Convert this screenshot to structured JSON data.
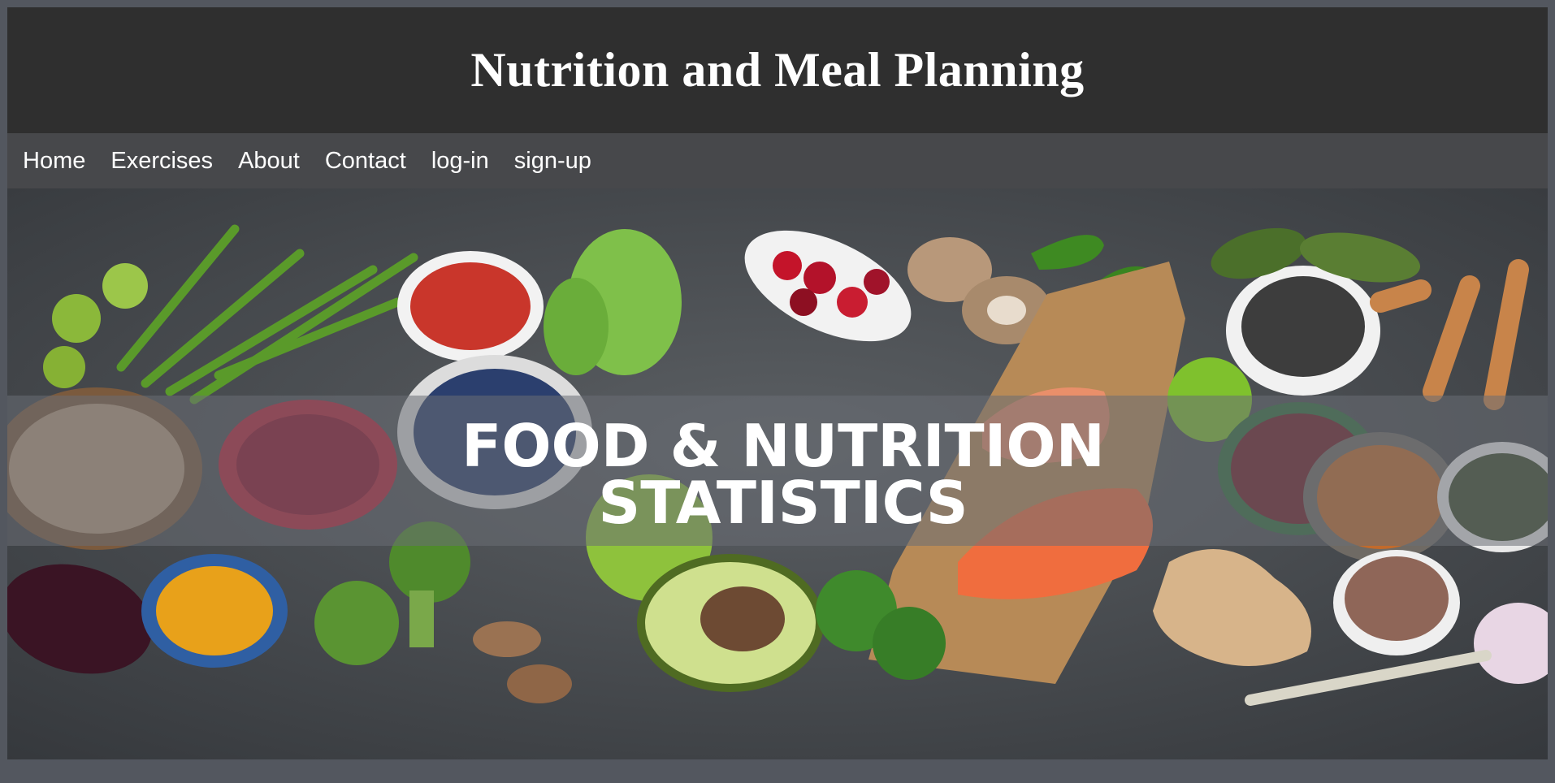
{
  "site": {
    "title": "Nutrition and Meal Planning"
  },
  "nav": {
    "items": [
      "Home",
      "Exercises",
      "About",
      "Contact",
      "log-in",
      "sign-up"
    ]
  },
  "hero": {
    "banner_line1": "FOOD & NUTRITION",
    "banner_line2": "STATISTICS"
  },
  "colors": {
    "header_bg": "#2f2f2f",
    "nav_bg": "#47484b",
    "page_bg": "#53575f",
    "banner_text": "#ffffff"
  }
}
